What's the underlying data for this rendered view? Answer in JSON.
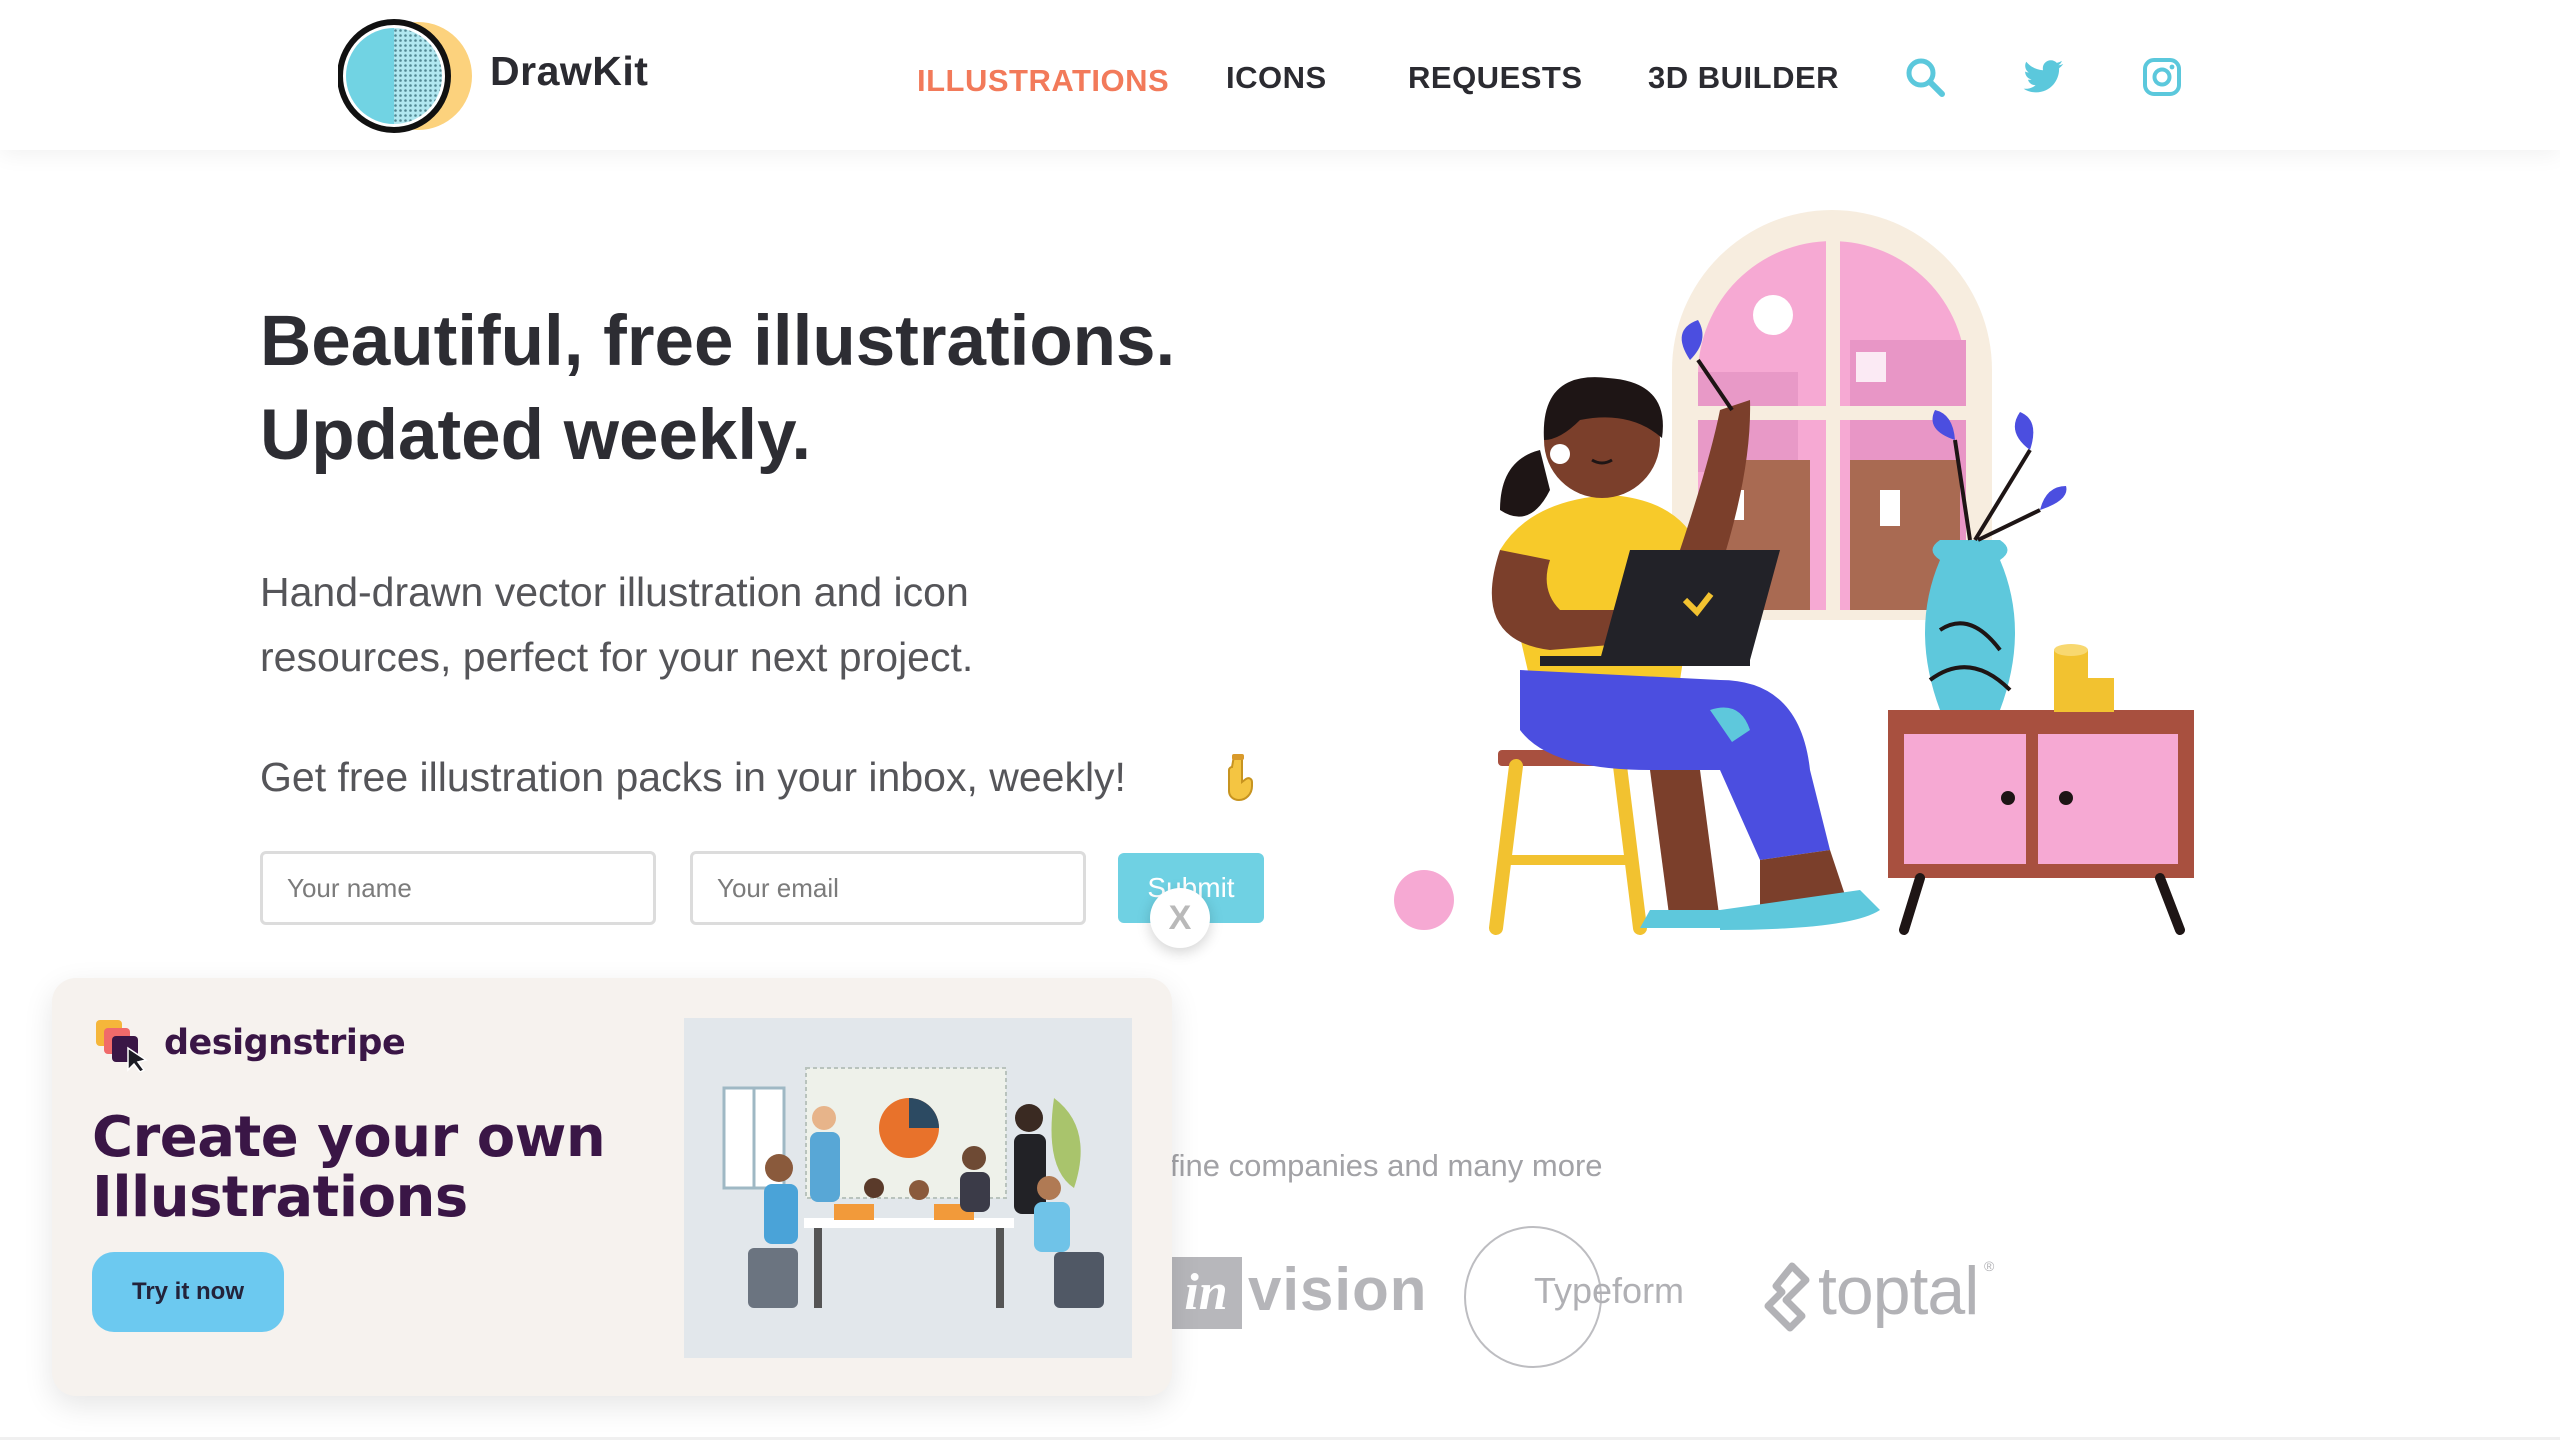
{
  "header": {
    "brand": "DrawKit",
    "nav": [
      {
        "label": "ILLUSTRATIONS",
        "active": true
      },
      {
        "label": "ICONS"
      },
      {
        "label": "REQUESTS"
      },
      {
        "label": "3D BUILDER"
      }
    ],
    "icons": [
      "search-icon",
      "twitter-icon",
      "instagram-icon"
    ],
    "accent_color": "#f27a5a",
    "icon_color": "#5bc8dc"
  },
  "hero": {
    "title_line1": "Beautiful, free illustrations.",
    "title_line2": "Updated weekly.",
    "subtitle": "Hand-drawn vector illustration and icon resources, perfect for your next project.",
    "cta_text": "Get free illustration packs in your inbox, weekly!",
    "cta_icon": "pointing-down-hand-icon"
  },
  "signup": {
    "name_placeholder": "Your name",
    "email_placeholder": "Your email",
    "submit_label": "Submit",
    "close_label": "X",
    "submit_color": "#6fd1e3"
  },
  "companies": {
    "text": "fine companies and many more",
    "logos": {
      "invision_in": "in",
      "invision_rest": "vision",
      "typeform": "Typeform",
      "toptal": "toptal",
      "toptal_mark": "®"
    }
  },
  "promo": {
    "brand": "designstripe",
    "title": "Create your own Illustrations",
    "button": "Try it now",
    "brand_color": "#3a1646",
    "button_color": "#6cc9f0"
  }
}
